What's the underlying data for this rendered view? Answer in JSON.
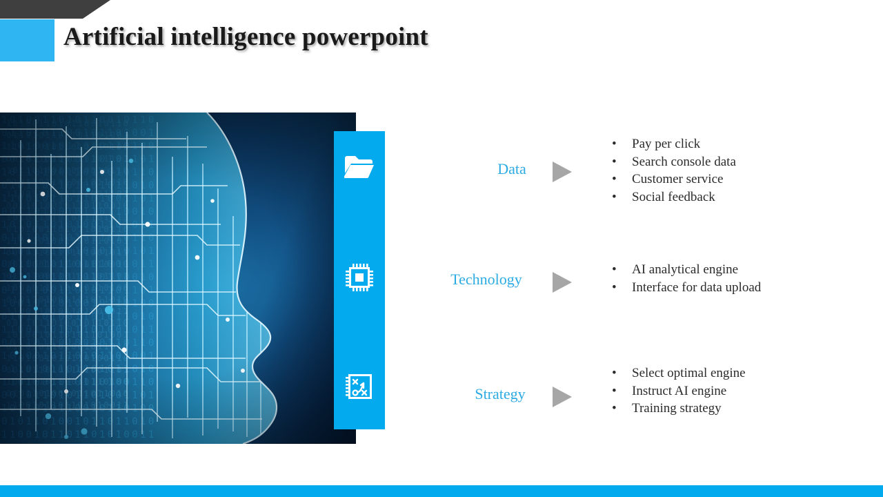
{
  "header": {
    "title": "Artificial intelligence powerpoint",
    "accent_color": "#2fb6f2",
    "band_color": "#3f3f3f"
  },
  "hero": {
    "alt": "artificial-intelligence-head-circuit-binary-image",
    "background_colors": [
      "#041c32",
      "#0d3d68",
      "#1f7fb8"
    ],
    "binary_rows": [
      "1010011010110010110",
      "0110101100101101001",
      "1101001011010110100",
      "0010110100110101101",
      "1011010011010010110",
      "0101101101001011010",
      "1100101101101001101",
      "0011010010110110010",
      "1010110101001101011",
      "0101001101011010110",
      "1101101001010110101",
      "0010110110101001011",
      "1011001011010110010",
      "0110100110101101101",
      "1001011010010110100",
      "0101101001101011010",
      "1100110101101001011",
      "0011011010010110110",
      "1010010110101101001",
      "0110101101001011010",
      "1101001010110100110",
      "0010110101101001101",
      "1011010110010110100",
      "0101101001011011010",
      "1100101101101010011"
    ]
  },
  "icon_panel": {
    "background_color": "#03abee",
    "icons": [
      {
        "name": "folder-icon",
        "label": "Data"
      },
      {
        "name": "microchip-icon",
        "label": "Technology"
      },
      {
        "name": "strategy-playbook-icon",
        "label": "Strategy"
      }
    ]
  },
  "rows": [
    {
      "label": "Data",
      "label_color": "#2cabe3",
      "arrow_color": "#a6a6a6",
      "bullets": [
        "Pay per click",
        "Search console data",
        "Customer service",
        "Social feedback"
      ]
    },
    {
      "label": "Technology",
      "label_color": "#2cabe3",
      "arrow_color": "#a6a6a6",
      "bullets": [
        "AI analytical engine",
        "Interface for data upload"
      ]
    },
    {
      "label": "Strategy",
      "label_color": "#2cabe3",
      "arrow_color": "#a6a6a6",
      "bullets": [
        "Select optimal engine",
        "Instruct AI engine",
        "Training strategy"
      ]
    }
  ],
  "footer": {
    "color": "#03abee"
  },
  "bullet_glyph": "•"
}
